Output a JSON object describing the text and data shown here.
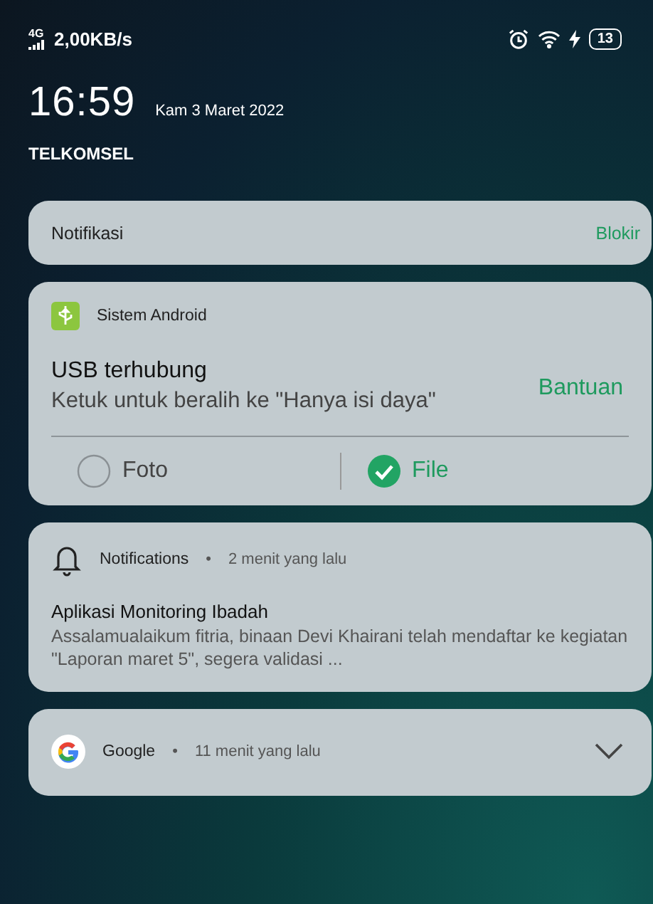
{
  "status_bar": {
    "network": "4G",
    "speed": "2,00KB/s",
    "battery": "13"
  },
  "header": {
    "time": "16:59",
    "date": "Kam 3 Maret 2022",
    "carrier": "TELKOMSEL"
  },
  "notification_settings": {
    "label": "Notifikasi",
    "action": "Blokir"
  },
  "notifications": [
    {
      "kind": "usb",
      "app": "Sistem Android",
      "title": "USB terhubung",
      "text": "Ketuk untuk beralih ke \"Hanya isi daya\"",
      "action": "Bantuan",
      "options": [
        {
          "label": "Foto",
          "selected": false
        },
        {
          "label": "File",
          "selected": true
        }
      ]
    },
    {
      "kind": "message",
      "app": "Notifications",
      "separator": "•",
      "time": "2 menit yang lalu",
      "title": "Aplikasi Monitoring Ibadah",
      "text": "Assalamualaikum fitria, binaan Devi Khairani telah mendaftar ke kegiatan \"Laporan maret 5\", segera validasi ..."
    },
    {
      "kind": "collapsed",
      "app": "Google",
      "separator": "•",
      "time": "11 menit yang lalu",
      "expanded": false
    }
  ]
}
